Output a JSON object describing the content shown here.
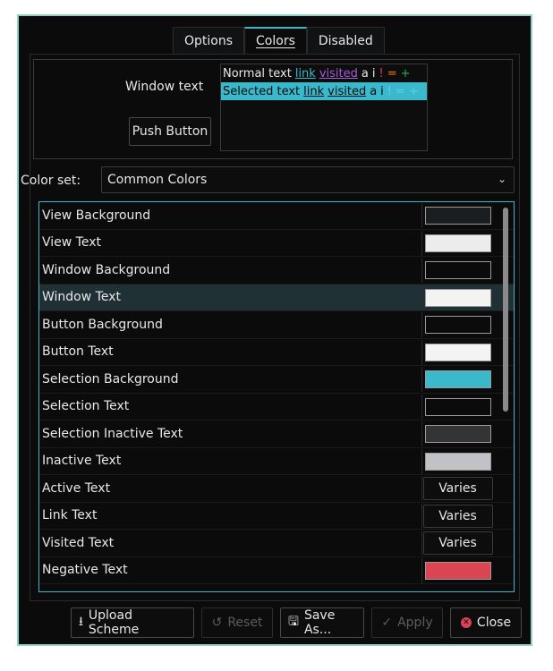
{
  "tabs": [
    {
      "label": "Options",
      "active": false
    },
    {
      "label": "Colors",
      "active": true
    },
    {
      "label": "Disabled",
      "active": false
    }
  ],
  "preview": {
    "window_text": "Window text",
    "push_button": "Push Button",
    "normal": {
      "text": "Normal text",
      "link": "link",
      "visited": "visited",
      "a": "a",
      "i": "i",
      "neg": "!",
      "neu": "=",
      "pos": "+"
    },
    "selected": {
      "text": "Selected text",
      "link": "link",
      "visited": "visited",
      "a": "a",
      "i": "i",
      "neg": "!",
      "neu": "=",
      "pos": "+"
    }
  },
  "color_set": {
    "label": "Color set:",
    "value": "Common Colors"
  },
  "rows": [
    {
      "label": "View Background",
      "color": "#1b1e20"
    },
    {
      "label": "View Text",
      "color": "#ececec"
    },
    {
      "label": "Window Background",
      "color": "#0b0b0c"
    },
    {
      "label": "Window Text",
      "color": "#f3f3f3",
      "selected": true
    },
    {
      "label": "Button Background",
      "color": "#0b0b0c"
    },
    {
      "label": "Button Text",
      "color": "#f3f3f3"
    },
    {
      "label": "Selection Background",
      "color": "#3ab8cc"
    },
    {
      "label": "Selection Text",
      "color": "#0b0b0c"
    },
    {
      "label": "Selection Inactive Text",
      "color": "#333436"
    },
    {
      "label": "Inactive Text",
      "color": "#c0c2c5"
    },
    {
      "label": "Active Text",
      "varies": "Varies"
    },
    {
      "label": "Link Text",
      "varies": "Varies"
    },
    {
      "label": "Visited Text",
      "varies": "Varies"
    },
    {
      "label": "Negative Text",
      "color": "#da4453"
    }
  ],
  "footer": {
    "upload": "Upload Scheme",
    "reset": "Reset",
    "save_as": "Save As...",
    "apply": "Apply",
    "close": "Close"
  },
  "colors": {
    "accent": "#3ab8cc",
    "border": "#8fd1c0",
    "negative": "#da4453"
  }
}
